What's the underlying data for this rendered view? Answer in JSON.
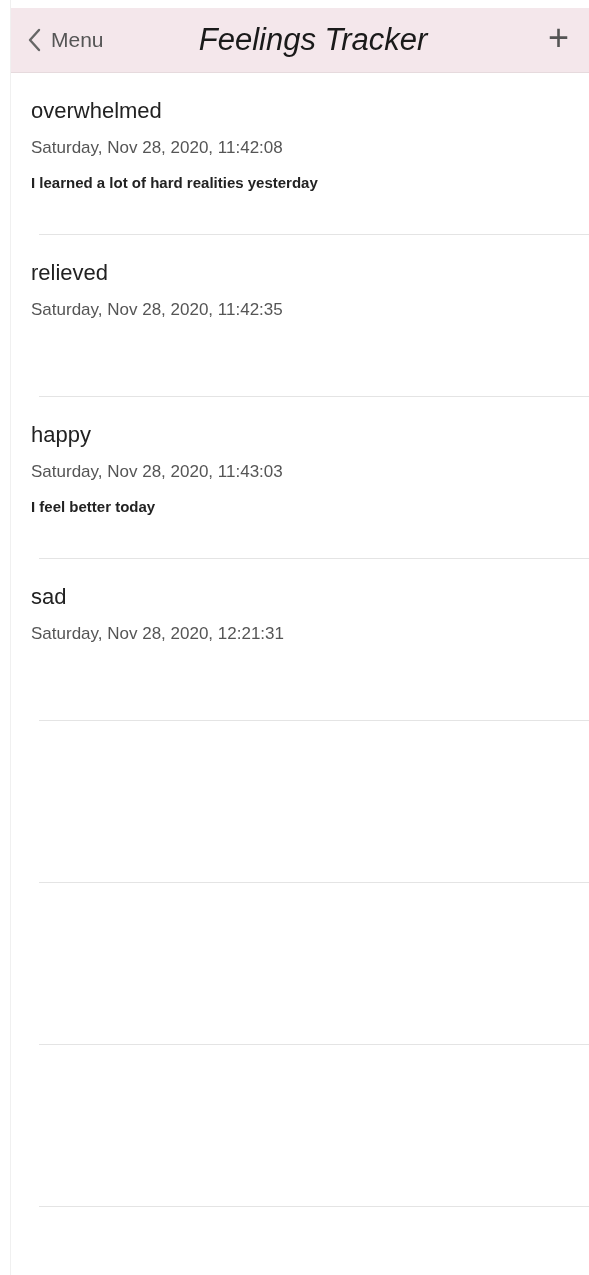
{
  "nav_bar": {
    "back_label": "Menu",
    "title": "Feelings Tracker",
    "add_label": "+"
  },
  "entries": [
    {
      "feeling": "overwhelmed",
      "timestamp": "Saturday, Nov 28, 2020, 11:42:08",
      "note": "I learned a lot of hard realities yesterday"
    },
    {
      "feeling": "relieved",
      "timestamp": "Saturday, Nov 28, 2020, 11:42:35"
    },
    {
      "feeling": "happy",
      "timestamp": "Saturday, Nov 28, 2020, 11:43:03",
      "note": "I feel better today"
    },
    {
      "feeling": "sad",
      "timestamp": "Saturday, Nov 28, 2020, 12:21:31"
    }
  ]
}
